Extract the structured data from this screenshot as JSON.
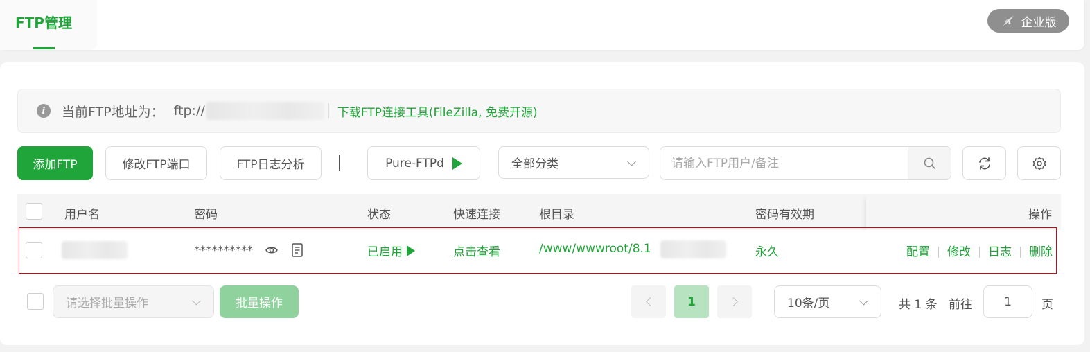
{
  "header": {
    "tab_label": "FTP管理",
    "edition_badge": "企业版"
  },
  "info_bar": {
    "icon": "info-icon",
    "label": "当前FTP地址为：",
    "url_prefix": "ftp://",
    "link_text": "下载FTP连接工具(FileZilla, 免费开源)"
  },
  "toolbar": {
    "add_label": "添加FTP",
    "modify_port_label": "修改FTP端口",
    "log_analysis_label": "FTP日志分析",
    "service_label": "Pure-FTPd",
    "category_value": "全部分类",
    "search_placeholder": "请输入FTP用户/备注",
    "icons": [
      "search-icon",
      "refresh-icon",
      "gear-icon",
      "play-icon"
    ]
  },
  "table": {
    "columns": [
      "用户名",
      "密码",
      "状态",
      "快速连接",
      "根目录",
      "密码有效期",
      "操作"
    ],
    "rows": [
      {
        "password": "**********",
        "status": "已启用",
        "quick_connect": "点击查看",
        "root_dir": "/www/wwwroot/8.1",
        "expiry": "永久",
        "actions": [
          "配置",
          "修改",
          "日志",
          "删除"
        ]
      }
    ]
  },
  "footer": {
    "batch_placeholder": "请选择批量操作",
    "batch_button": "批量操作",
    "current_page": "1",
    "page_size": "10条/页",
    "total_prefix": "共",
    "total_count": "1",
    "total_suffix": "条",
    "goto_label": "前往",
    "goto_value": "1",
    "page_suffix": "页"
  },
  "colors": {
    "accent": "#20a53a",
    "highlight_border": "#d9000b",
    "badge_bg": "#8f8f8f"
  }
}
